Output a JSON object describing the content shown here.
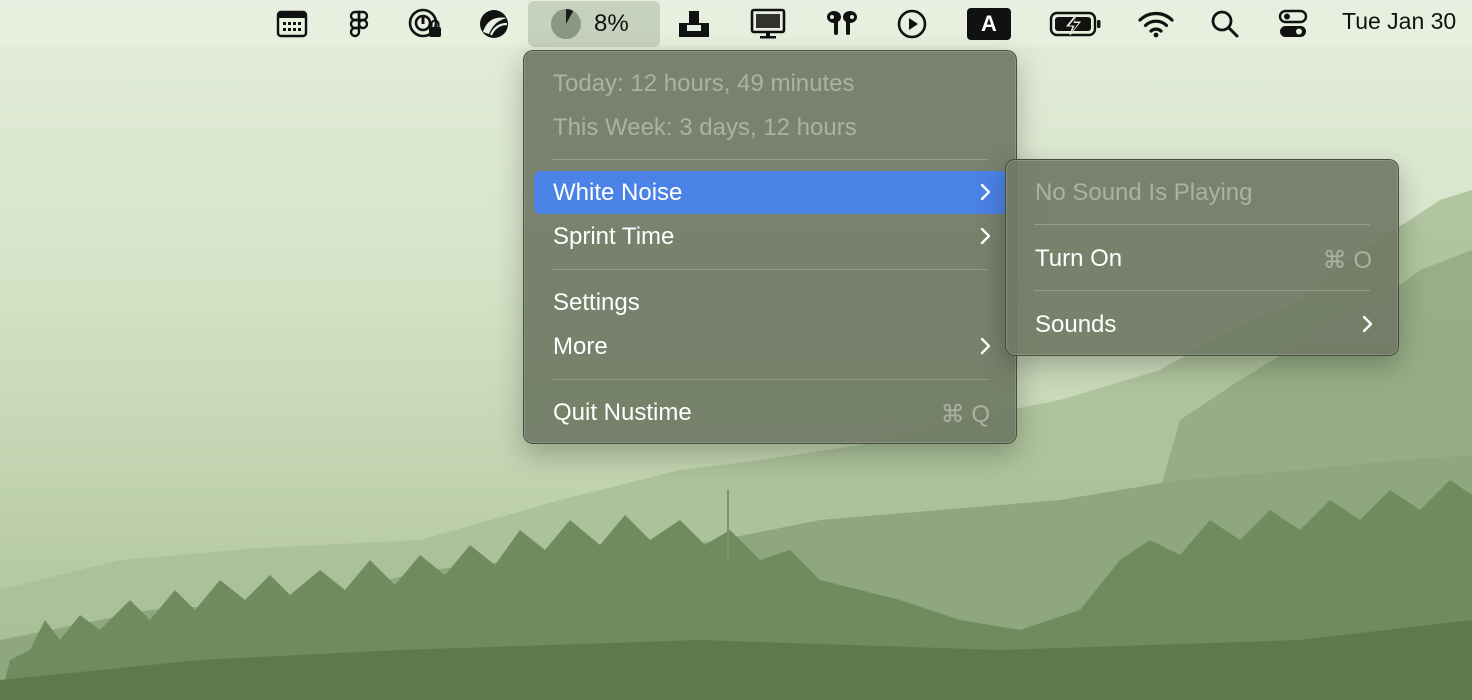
{
  "menubar": {
    "icons": [
      "calendar-icon",
      "figma-icon",
      "privacy-lock-icon",
      "app-logo-icon",
      "pie-timer-icon",
      "dock-icon",
      "display-icon",
      "airpods-icon",
      "play-icon",
      "input-source-icon",
      "battery-icon",
      "wifi-icon",
      "search-icon",
      "control-center-icon"
    ],
    "status_percent_text": "8%",
    "status_progress": 0.08,
    "input_source_label": "A",
    "clock": "Tue Jan 30"
  },
  "main_menu": {
    "today": "Today: 12 hours, 49 minutes",
    "this_week": "This Week: 3 days, 12 hours",
    "white_noise": "White Noise",
    "sprint_time": "Sprint Time",
    "settings": "Settings",
    "more": "More",
    "quit": "Quit Nustime",
    "quit_shortcut": "⌘ Q"
  },
  "sub_menu": {
    "status": "No Sound Is Playing",
    "turn_on": "Turn On",
    "turn_on_shortcut": "⌘ O",
    "sounds": "Sounds"
  },
  "colors": {
    "highlight": "#4b82e6",
    "menu_bg": "#707a64",
    "menubar_bg": "#e8f0e1"
  }
}
